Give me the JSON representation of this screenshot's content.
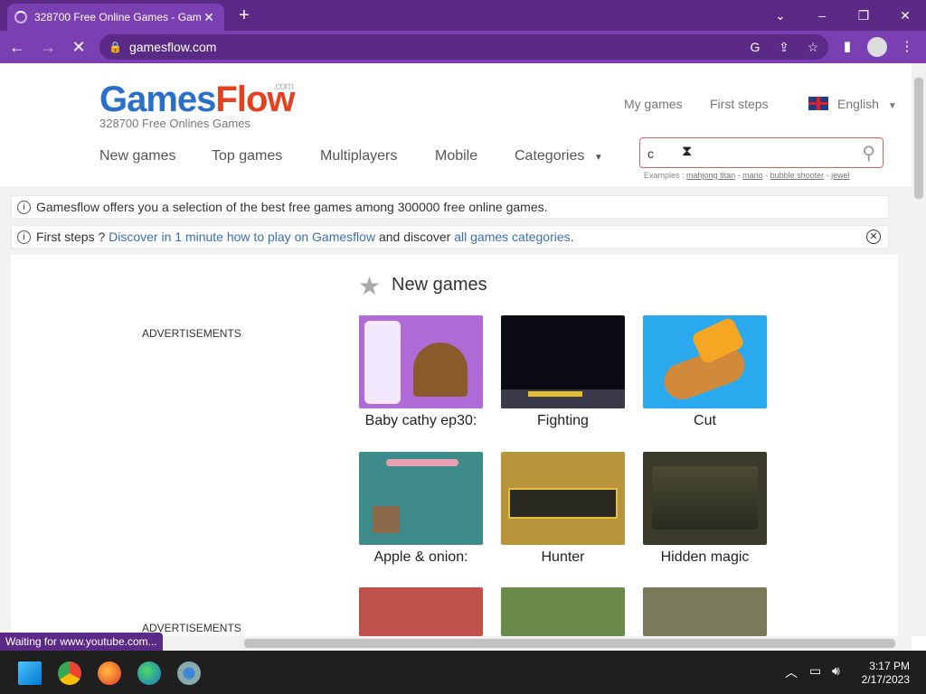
{
  "browser": {
    "tab_title": "328700 Free Online Games - Gam",
    "url": "gamesflow.com",
    "status": "Waiting for www.youtube.com..."
  },
  "site": {
    "logo_part1": "Games",
    "logo_part2": "Flow",
    "logo_suffix": ".com",
    "tagline": "328700 Free Onlines Games",
    "top_links": [
      "My games",
      "First steps"
    ],
    "language": "English",
    "menu": [
      "New games",
      "Top games",
      "Multiplayers",
      "Mobile",
      "Categories"
    ],
    "search_value": "c",
    "examples_label": "Examples :",
    "examples": [
      "mahjong titan",
      "mario",
      "bubble shooter",
      "jewel"
    ],
    "info1": "Gamesflow offers you a selection of the best free games among 300000 free online games.",
    "info2_prefix": "First steps ?",
    "info2_link1": "Discover in 1 minute how to play on Gamesflow",
    "info2_middle": "and discover",
    "info2_link2": "all games categories",
    "info2_suffix": ".",
    "ads_label": "ADVERTISEMENTS",
    "section_title": "New games",
    "games": [
      {
        "name": "Baby cathy ep30:",
        "color": "#b06bd8"
      },
      {
        "name": "Fighting",
        "color": "#0b0b14"
      },
      {
        "name": "Cut",
        "color": "#2aa9ef"
      },
      {
        "name": "Apple & onion:",
        "color": "#3f8a8a"
      },
      {
        "name": "Hunter",
        "color": "#b8953a"
      },
      {
        "name": "Hidden magic",
        "color": "#3a3a2a"
      }
    ]
  },
  "taskbar": {
    "time": "3:17 PM",
    "date": "2/17/2023"
  },
  "colors": {
    "brand_blue": "#2a6fc9",
    "brand_red": "#e3411f",
    "browser_purple": "#7a3fb0"
  }
}
